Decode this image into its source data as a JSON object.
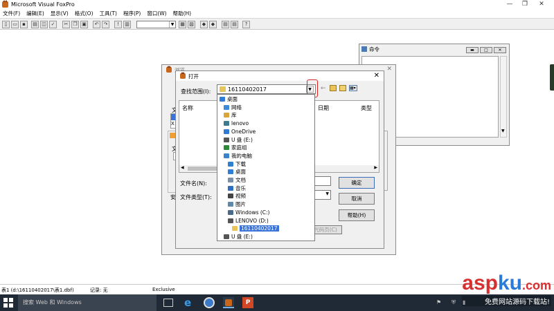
{
  "app": {
    "title": "Microsoft Visual FoxPro"
  },
  "window_controls": {
    "minimize": "—",
    "restore": "❐",
    "close": "✕"
  },
  "menu": [
    "文件(F)",
    "编辑(E)",
    "显示(V)",
    "格式(O)",
    "工具(T)",
    "程序(P)",
    "窗口(W)",
    "帮助(H)"
  ],
  "command_window": {
    "title": "命令"
  },
  "back_dialog": {
    "title": "浏览",
    "labels": [
      "文",
      "X",
      "文"
    ],
    "radio_label": "安"
  },
  "open_dialog": {
    "title": "打开",
    "lookin_label": "查找范围(I):",
    "lookin_value": "16110402017",
    "col_name": "名称",
    "col_date": "日期",
    "col_type": "类型",
    "filename_label": "文件名(N):",
    "filetype_label": "文件类型(T):",
    "ok_button": "确定",
    "cancel_button": "取消",
    "help_button": "帮助(H)",
    "code_page_button": "代码页(C)"
  },
  "dropdown": {
    "items": [
      {
        "label": "桌面",
        "icon": "desktop-icon",
        "indent": 0,
        "color": "#2e7dd7"
      },
      {
        "label": "网络",
        "icon": "network-icon",
        "indent": 1,
        "color": "#3c8ad8"
      },
      {
        "label": "库",
        "icon": "library-icon",
        "indent": 1,
        "color": "#d9a43a"
      },
      {
        "label": "lenovo",
        "icon": "user-icon",
        "indent": 1,
        "color": "#3d7a8e"
      },
      {
        "label": "OneDrive",
        "icon": "cloud-icon",
        "indent": 1,
        "color": "#2f7bd3"
      },
      {
        "label": "U 盘 (E:)",
        "icon": "drive-icon",
        "indent": 1,
        "color": "#555555"
      },
      {
        "label": "家庭组",
        "icon": "homegroup-icon",
        "indent": 1,
        "color": "#2a8a3a"
      },
      {
        "label": "我的电脑",
        "icon": "computer-icon",
        "indent": 1,
        "color": "#3a83c8"
      },
      {
        "label": "下载",
        "icon": "download-icon",
        "indent": 2,
        "color": "#2f7fd0"
      },
      {
        "label": "桌面",
        "icon": "desktop-icon",
        "indent": 2,
        "color": "#2e7dd7"
      },
      {
        "label": "文档",
        "icon": "document-icon",
        "indent": 2,
        "color": "#7a8fa6"
      },
      {
        "label": "音乐",
        "icon": "music-icon",
        "indent": 2,
        "color": "#2f6fc0"
      },
      {
        "label": "视频",
        "icon": "video-icon",
        "indent": 2,
        "color": "#444444"
      },
      {
        "label": "图片",
        "icon": "picture-icon",
        "indent": 2,
        "color": "#5d8aa8"
      },
      {
        "label": "Windows (C:)",
        "icon": "drive-icon",
        "indent": 2,
        "color": "#4a6a8a"
      },
      {
        "label": "LENOVO (D:)",
        "icon": "drive-icon",
        "indent": 2,
        "color": "#555555"
      },
      {
        "label": "16110402017",
        "icon": "folder-icon",
        "indent": 3,
        "color": "#e8c45a",
        "selected": true
      },
      {
        "label": "U 盘 (E:)",
        "icon": "drive-icon",
        "indent": 1,
        "color": "#555555"
      }
    ]
  },
  "status": {
    "left": "表1 (d:\\16110402017\\表1.dbf)",
    "record": "记录: 无",
    "mode": "Exclusive"
  },
  "taskbar": {
    "search_placeholder": "搜索 Web 和 Windows",
    "logo_text": "asp",
    "logo_text2": "ku",
    "logo_dot": ".com",
    "tagline": "免费网站源码下载站!"
  }
}
